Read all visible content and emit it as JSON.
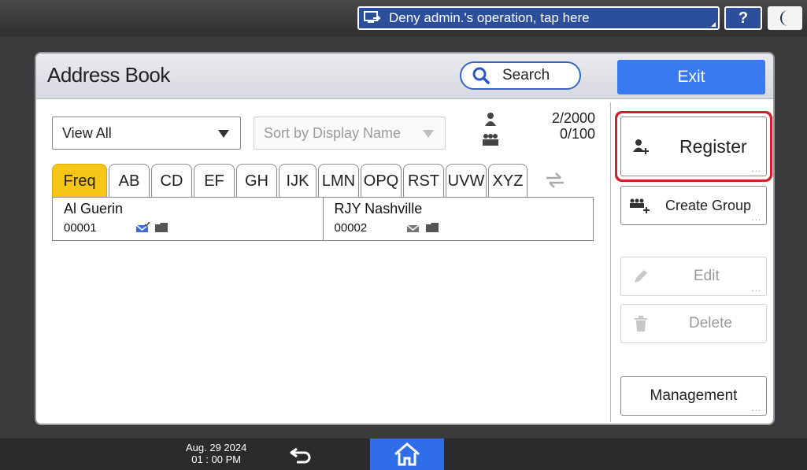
{
  "topbar": {
    "deny_label": "Deny admin.'s operation, tap here",
    "help_label": "?"
  },
  "address_book": {
    "title": "Address Book",
    "search_label": "Search",
    "exit_label": "Exit"
  },
  "filters": {
    "view_value": "View All",
    "sort_value": "Sort by Display Name",
    "count_users": "2/2000",
    "count_groups": "0/100"
  },
  "tabs": [
    "Freq",
    "AB",
    "CD",
    "EF",
    "GH",
    "IJK",
    "LMN",
    "OPQ",
    "RST",
    "UVW",
    "XYZ"
  ],
  "active_tab": "Freq",
  "entries": [
    {
      "name": "Al Guerin",
      "number": "00001"
    },
    {
      "name": "RJY Nashville",
      "number": "00002"
    }
  ],
  "side": {
    "register_label": "Register",
    "create_group_label": "Create Group",
    "edit_label": "Edit",
    "delete_label": "Delete",
    "management_label": "Management",
    "more_dots": "..."
  },
  "bottombar": {
    "date": "Aug. 29 2024",
    "time": "01 : 00 PM"
  },
  "colors": {
    "accent_blue": "#3a7af0",
    "active_tab": "#f5c518",
    "highlight_red": "#d0212b"
  }
}
